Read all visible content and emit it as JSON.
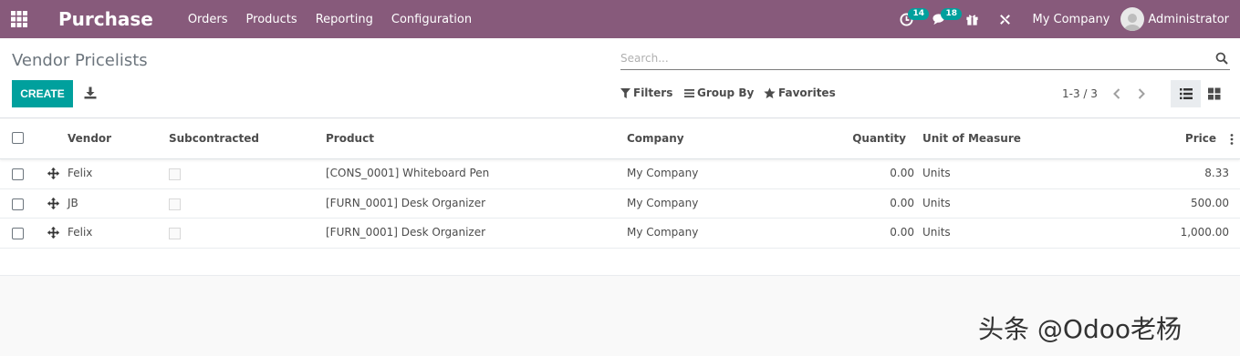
{
  "navbar": {
    "app_name": "Purchase",
    "menu": [
      "Orders",
      "Products",
      "Reporting",
      "Configuration"
    ],
    "activity_count": "14",
    "messages_count": "18",
    "company": "My Company",
    "user": "Administrator"
  },
  "control_panel": {
    "title": "Vendor Pricelists",
    "search_placeholder": "Search...",
    "create_label": "CREATE",
    "filters_label": "Filters",
    "group_by_label": "Group By",
    "favorites_label": "Favorites",
    "pager": "1-3 / 3"
  },
  "table": {
    "columns": {
      "vendor": "Vendor",
      "subcontracted": "Subcontracted",
      "product": "Product",
      "company": "Company",
      "quantity": "Quantity",
      "uom": "Unit of Measure",
      "price": "Price"
    },
    "rows": [
      {
        "vendor": "Felix",
        "product": "[CONS_0001] Whiteboard Pen",
        "company": "My Company",
        "quantity": "0.00",
        "uom": "Units",
        "price": "8.33"
      },
      {
        "vendor": "JB",
        "product": "[FURN_0001] Desk Organizer",
        "company": "My Company",
        "quantity": "0.00",
        "uom": "Units",
        "price": "500.00"
      },
      {
        "vendor": "Felix",
        "product": "[FURN_0001] Desk Organizer",
        "company": "My Company",
        "quantity": "0.00",
        "uom": "Units",
        "price": "1,000.00"
      }
    ]
  },
  "watermark": "头条 @Odoo老杨",
  "colors": {
    "brand": "#875a7b",
    "accent": "#00a09d"
  },
  "icons": [
    "apps-grid-icon",
    "search-icon",
    "download-icon",
    "filter-icon",
    "group-by-icon",
    "star-icon",
    "chevron-left-icon",
    "chevron-right-icon",
    "list-view-icon",
    "kanban-view-icon",
    "activity-clock-icon",
    "chat-icon",
    "gift-icon",
    "debug-tools-icon",
    "drag-handle-icon"
  ]
}
